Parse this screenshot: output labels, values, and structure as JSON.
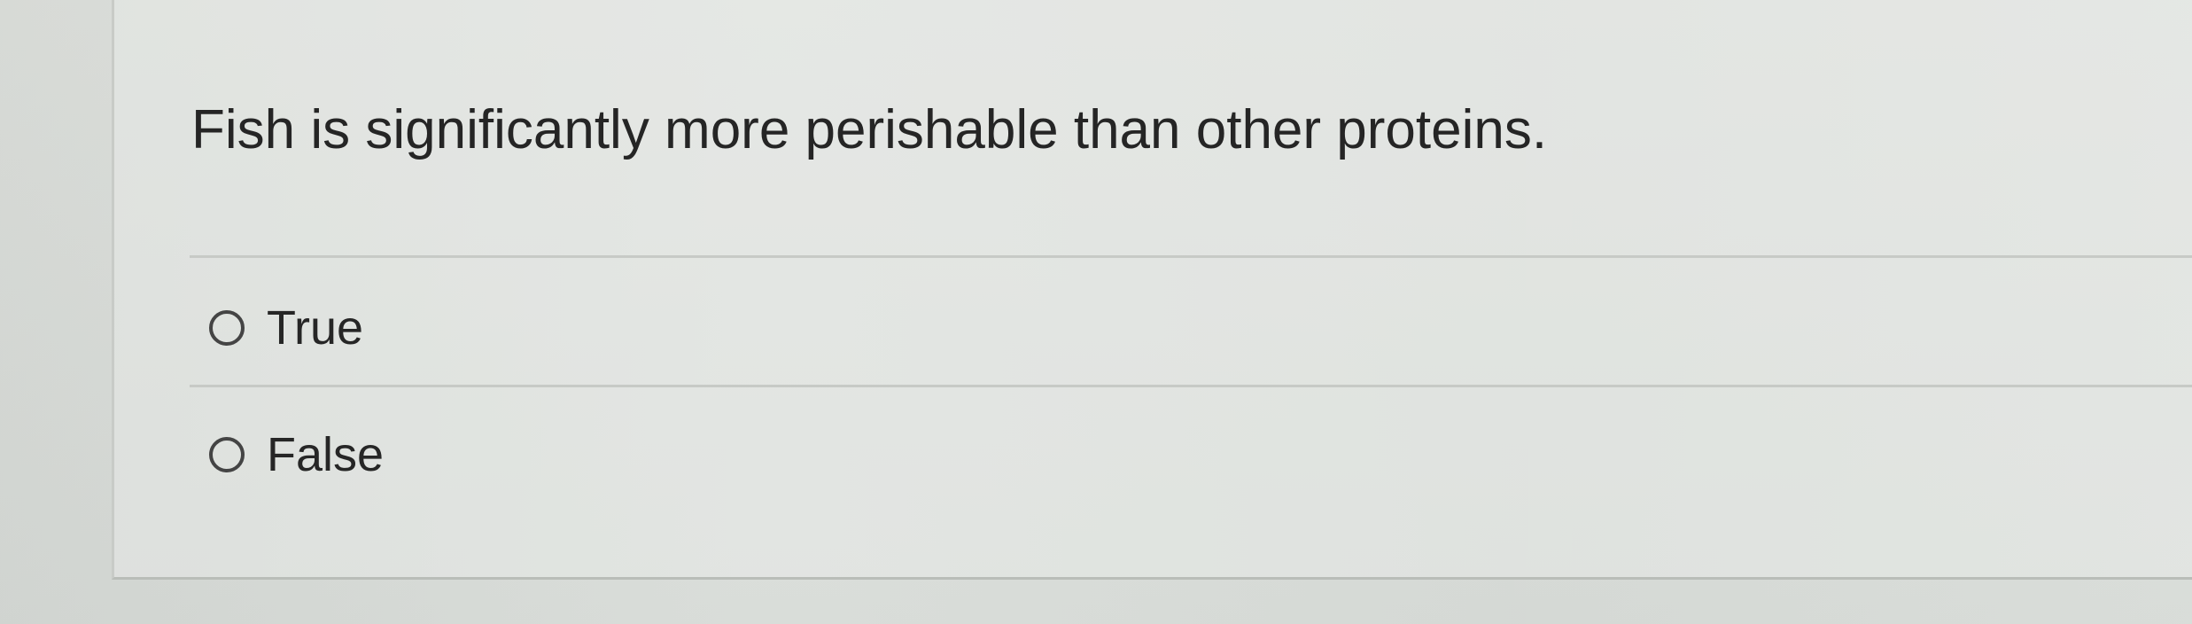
{
  "question": {
    "text": "Fish is significantly more perishable than other proteins."
  },
  "answers": [
    {
      "label": "True",
      "selected": false,
      "control": "radio"
    },
    {
      "label": "False",
      "selected": false,
      "control": "radio"
    }
  ],
  "colors": {
    "background": "#dcdfdb",
    "text": "#262626",
    "divider": "#c7cac6",
    "radio_border": "#444444"
  }
}
